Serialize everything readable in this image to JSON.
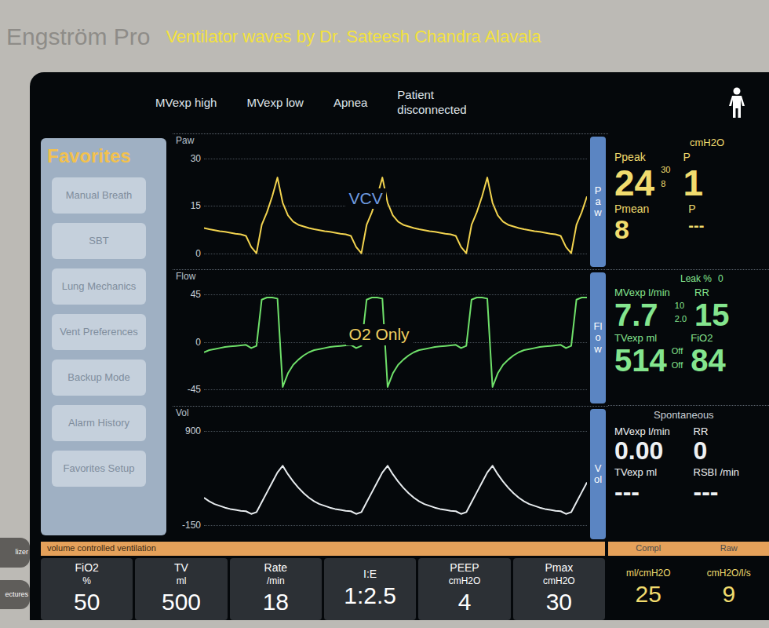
{
  "device": {
    "brand": "Engström Pro",
    "caption": "Ventilator waves by Dr. Sateesh Chandra Alavala",
    "side_keys": [
      "lizer",
      "ectures"
    ]
  },
  "alarms": [
    {
      "label": "MVexp high"
    },
    {
      "label": "MVexp low"
    },
    {
      "label": "Apnea"
    },
    {
      "label": "Patient disconnected"
    }
  ],
  "favorites": {
    "title": "Favorites",
    "buttons": [
      "Manual Breath",
      "SBT",
      "Lung Mechanics",
      "Vent Preferences",
      "Backup Mode",
      "Alarm History",
      "Favorites Setup"
    ]
  },
  "graphs": [
    {
      "label": "Paw",
      "tab": "Paw",
      "ticks": [
        "30",
        "15",
        "0"
      ],
      "color": "#f2d34f",
      "overlay": "VCV",
      "overlay_color": "#6f9be0",
      "values": [
        8,
        7.6,
        7.3,
        7,
        6.8,
        6.5,
        6.2,
        6,
        5.5,
        2,
        0,
        9,
        13,
        18,
        24,
        16,
        12,
        10,
        9,
        8.5,
        8,
        7.6,
        7.3,
        7,
        6.8,
        6.5,
        6.2,
        6,
        5.5,
        2,
        0,
        9,
        13,
        18,
        24,
        16,
        12,
        10,
        9,
        8.5,
        8,
        7.6,
        7.3,
        7,
        6.8,
        6.5,
        6.2,
        6,
        5.5,
        2,
        0,
        9,
        13,
        18,
        24,
        16,
        12,
        10,
        9,
        8.5,
        8,
        7.6,
        7.3,
        7,
        6.8,
        6.5,
        6.2,
        6,
        5.5,
        2,
        0,
        9,
        13,
        18
      ]
    },
    {
      "label": "Flow",
      "tab": "Flow",
      "ticks": [
        "45",
        "0",
        "-45"
      ],
      "color": "#6fe06a",
      "overlay": "O2 Only",
      "overlay_color": "#f0d060",
      "values": [
        -10,
        -8,
        -7,
        -6,
        -5,
        -4.5,
        -4,
        -3.5,
        -3,
        -6,
        -4,
        40,
        42,
        42,
        41,
        -43,
        -30,
        -22,
        -17,
        -13,
        -10,
        -8,
        -7,
        -6,
        -5,
        -4.5,
        -4,
        -3.5,
        -3,
        -6,
        -4,
        40,
        42,
        42,
        41,
        -43,
        -30,
        -22,
        -17,
        -13,
        -10,
        -8,
        -7,
        -6,
        -5,
        -4.5,
        -4,
        -3.5,
        -3,
        -6,
        -4,
        40,
        42,
        42,
        41,
        -43,
        -30,
        -22,
        -17,
        -13,
        -10,
        -8,
        -7,
        -6,
        -5,
        -4.5,
        -4,
        -3.5,
        -3,
        -6,
        -4,
        40,
        42,
        42
      ]
    },
    {
      "label": "Vol",
      "tab": "Vol",
      "ticks": [
        "900",
        "-150"
      ],
      "color": "#e8ecef",
      "overlay": "",
      "overlay_color": "#000000",
      "values": [
        160,
        120,
        90,
        70,
        50,
        35,
        25,
        15,
        10,
        -20,
        0,
        110,
        220,
        330,
        440,
        514,
        420,
        340,
        270,
        210,
        160,
        120,
        90,
        70,
        50,
        35,
        25,
        15,
        10,
        -20,
        0,
        110,
        220,
        330,
        440,
        514,
        420,
        340,
        270,
        210,
        160,
        120,
        90,
        70,
        50,
        35,
        25,
        15,
        10,
        -20,
        0,
        110,
        220,
        330,
        440,
        514,
        420,
        340,
        270,
        210,
        160,
        120,
        90,
        70,
        50,
        35,
        25,
        15,
        10,
        -20,
        0,
        110,
        220,
        330
      ]
    }
  ],
  "readings": {
    "unit": "cmH2O",
    "ppeak": {
      "label": "Ppeak",
      "value": "24",
      "high": "30",
      "low": "8"
    },
    "pmean": {
      "label": "Pmean",
      "value": "8"
    },
    "cut": [
      {
        "label": "P",
        "value": "1"
      },
      {
        "label": "P",
        "value": "---"
      }
    ],
    "leak": {
      "label": "Leak %",
      "value": "0"
    },
    "mvexp": {
      "label": "MVexp l/min",
      "value": "7.7",
      "high": "10",
      "low": "2.0"
    },
    "rr": {
      "label": "RR",
      "value": "15"
    },
    "tvexp": {
      "label": "TVexp ml",
      "value": "514",
      "high": "Off",
      "low": "Off"
    },
    "fio2": {
      "label": "FiO2",
      "value": "84"
    },
    "spontaneous": {
      "title": "Spontaneous",
      "items": [
        {
          "label": "MVexp l/min",
          "value": "0.00"
        },
        {
          "label": "RR",
          "value": "0"
        },
        {
          "label": "TVexp ml",
          "value": "---"
        },
        {
          "label": "RSBI /min",
          "value": "---"
        }
      ]
    }
  },
  "mode": "volume controlled ventilation",
  "settings": [
    {
      "label": "FiO2",
      "unit": "%",
      "value": "50"
    },
    {
      "label": "TV",
      "unit": "ml",
      "value": "500"
    },
    {
      "label": "Rate",
      "unit": "/min",
      "value": "18"
    },
    {
      "label": "I:E",
      "value": "1:2.5"
    },
    {
      "label": "PEEP",
      "unit": "cmH2O",
      "value": "4"
    },
    {
      "label": "Pmax",
      "unit": "cmH2O",
      "value": "30"
    }
  ],
  "mechanics": [
    {
      "label": "Compl",
      "unit": "ml/cmH2O",
      "value": "25"
    },
    {
      "label": "Raw",
      "unit": "cmH2O/l/s",
      "value": "9"
    }
  ]
}
